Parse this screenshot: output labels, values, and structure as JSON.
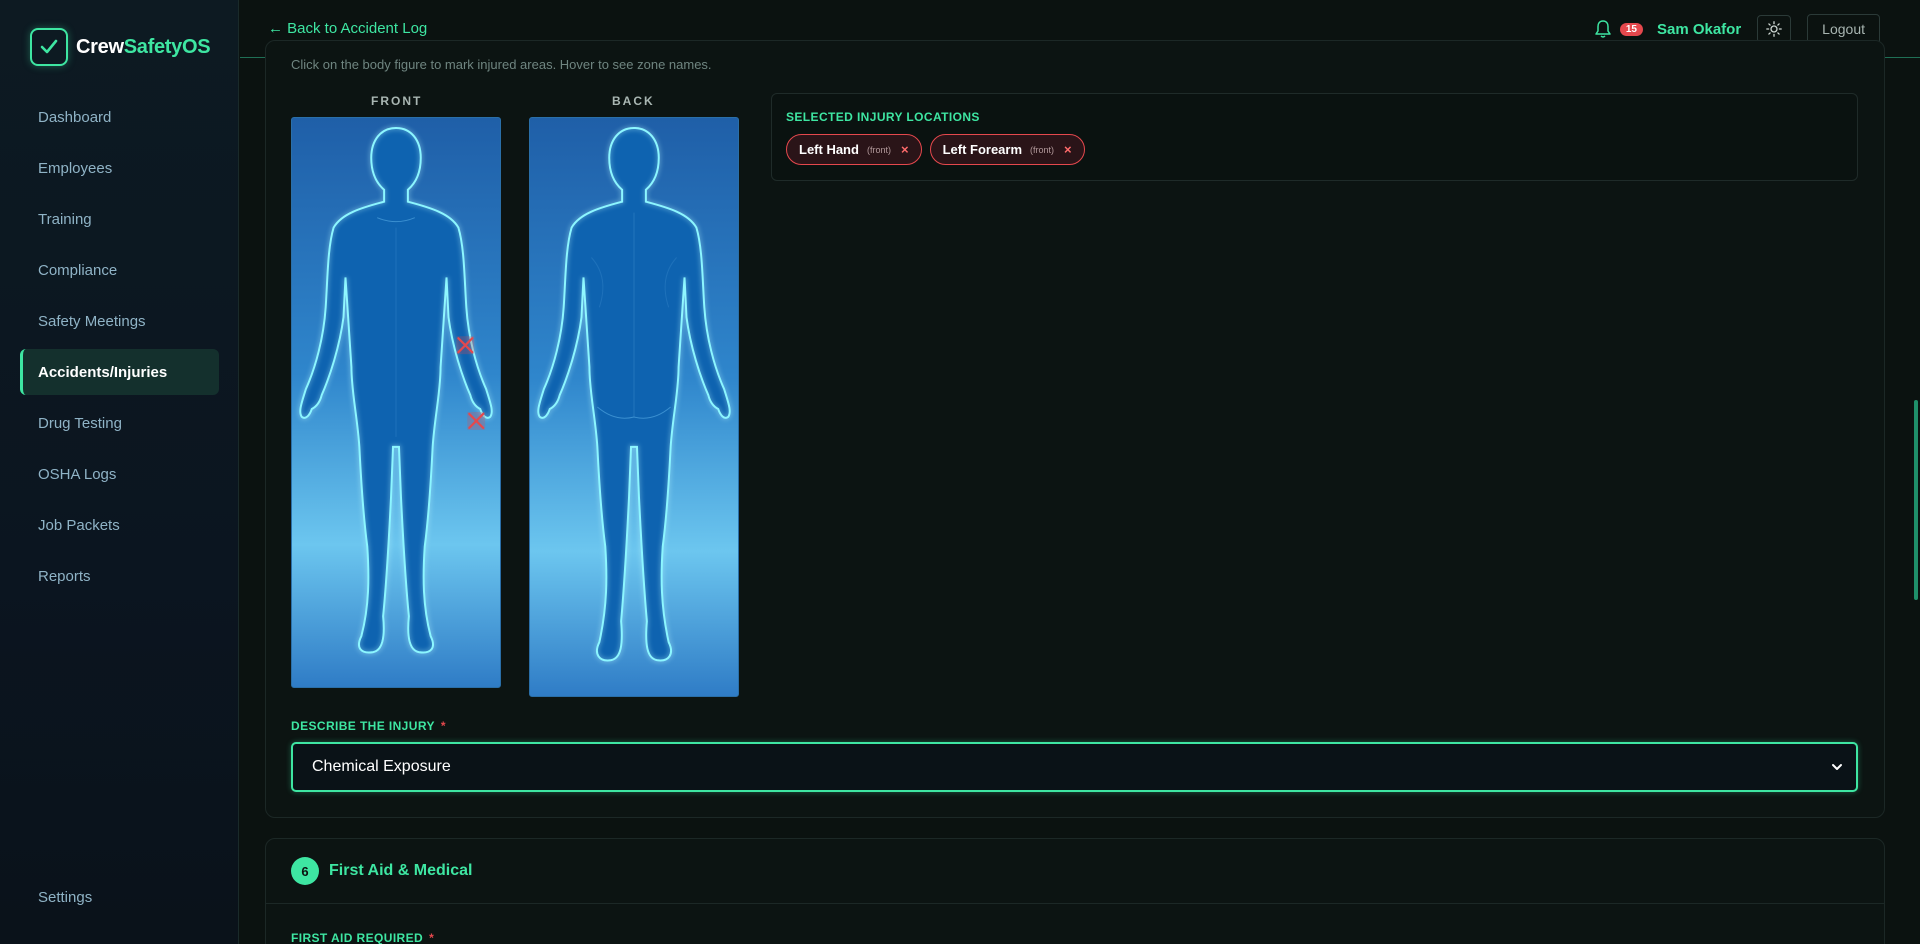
{
  "brand": {
    "name_part1": "Crew",
    "name_part2": "SafetyOS",
    "logo_icon": "check-icon",
    "accent": "#3ee6a2"
  },
  "sidebar": {
    "items": [
      {
        "label": "Dashboard"
      },
      {
        "label": "Employees"
      },
      {
        "label": "Training"
      },
      {
        "label": "Compliance"
      },
      {
        "label": "Safety Meetings"
      },
      {
        "label": "Accidents/Injuries",
        "active": true
      },
      {
        "label": "Drug Testing"
      },
      {
        "label": "OSHA Logs"
      },
      {
        "label": "Job Packets"
      },
      {
        "label": "Reports"
      }
    ],
    "settings_label": "Settings"
  },
  "topbar": {
    "back_label": "← Back to Accident Log",
    "notification_count": "15",
    "user_name": "Sam Okafor",
    "theme_icon": "sun-icon",
    "logout_label": "Logout"
  },
  "body_map": {
    "hint": "Click on the body figure to mark injured areas. Hover to see zone names.",
    "front_label": "FRONT",
    "back_label": "BACK",
    "selected_title": "SELECTED INJURY LOCATIONS",
    "selected": [
      {
        "label": "Left Hand",
        "side": "(front)",
        "remove": "×"
      },
      {
        "label": "Left Forearm",
        "side": "(front)",
        "remove": "×"
      }
    ],
    "marker_color": "#e5484d"
  },
  "injury": {
    "label": "DESCRIBE THE INJURY",
    "required_mark": "*",
    "selected_value": "Chemical Exposure"
  },
  "next_section": {
    "number": "6",
    "title": "First Aid & Medical",
    "field_label": "FIRST AID REQUIRED",
    "required_mark": "*"
  }
}
